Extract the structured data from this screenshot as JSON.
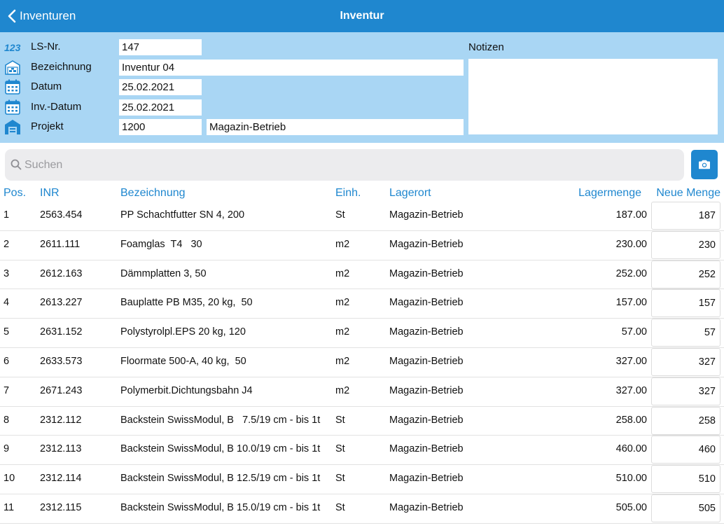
{
  "navbar": {
    "back_label": "Inventuren",
    "title": "Inventur",
    "bg_color": "#1f87cf"
  },
  "form": {
    "bg_color": "#a9d6f4",
    "ls_nr": {
      "label": "LS-Nr.",
      "value": "147",
      "icon": "numbers-123-icon"
    },
    "bezeichnung": {
      "label": "Bezeichnung",
      "value": "Inventur 04",
      "icon": "warehouse-icon"
    },
    "datum": {
      "label": "Datum",
      "value": "25.02.2021",
      "icon": "calendar-icon"
    },
    "inv_datum": {
      "label": "Inv.-Datum",
      "value": "25.02.2021",
      "icon": "calendar-icon"
    },
    "projekt": {
      "label": "Projekt",
      "value": "1200",
      "name": "Magazin-Betrieb",
      "icon": "building-icon"
    },
    "notizen": {
      "label": "Notizen",
      "value": ""
    }
  },
  "search": {
    "placeholder": "Suchen",
    "value": "",
    "camera_icon": "camera-icon"
  },
  "table": {
    "headers": {
      "pos": "Pos.",
      "inr": "INR",
      "bezeichnung": "Bezeichnung",
      "einh": "Einh.",
      "lagerort": "Lagerort",
      "lagermenge": "Lagermenge",
      "neue_menge": "Neue Menge"
    },
    "rows": [
      {
        "pos": "1",
        "inr": "2563.454",
        "bezeichnung": "PP Schachtfutter SN 4, 200",
        "einh": "St",
        "lagerort": "Magazin-Betrieb",
        "lagermenge": "187.00",
        "neue_menge": "187"
      },
      {
        "pos": "2",
        "inr": "2611.111",
        "bezeichnung": "Foamglas  T4   30",
        "einh": "m2",
        "lagerort": "Magazin-Betrieb",
        "lagermenge": "230.00",
        "neue_menge": "230"
      },
      {
        "pos": "3",
        "inr": "2612.163",
        "bezeichnung": "Dämmplatten 3, 50",
        "einh": "m2",
        "lagerort": "Magazin-Betrieb",
        "lagermenge": "252.00",
        "neue_menge": "252"
      },
      {
        "pos": "4",
        "inr": "2613.227",
        "bezeichnung": "Bauplatte PB M35, 20 kg,  50",
        "einh": "m2",
        "lagerort": "Magazin-Betrieb",
        "lagermenge": "157.00",
        "neue_menge": "157"
      },
      {
        "pos": "5",
        "inr": "2631.152",
        "bezeichnung": "Polystyrolpl.EPS 20 kg, 120",
        "einh": "m2",
        "lagerort": "Magazin-Betrieb",
        "lagermenge": "57.00",
        "neue_menge": "57"
      },
      {
        "pos": "6",
        "inr": "2633.573",
        "bezeichnung": "Floormate 500-A, 40 kg,  50",
        "einh": "m2",
        "lagerort": "Magazin-Betrieb",
        "lagermenge": "327.00",
        "neue_menge": "327"
      },
      {
        "pos": "7",
        "inr": "2671.243",
        "bezeichnung": "Polymerbit.Dichtungsbahn J4",
        "einh": "m2",
        "lagerort": "Magazin-Betrieb",
        "lagermenge": "327.00",
        "neue_menge": "327"
      },
      {
        "pos": "8",
        "inr": "2312.112",
        "bezeichnung": "Backstein SwissModul, B   7.5/19 cm - bis 1t",
        "einh": "St",
        "lagerort": "Magazin-Betrieb",
        "lagermenge": "258.00",
        "neue_menge": "258"
      },
      {
        "pos": "9",
        "inr": "2312.113",
        "bezeichnung": "Backstein SwissModul, B 10.0/19 cm - bis 1t",
        "einh": "St",
        "lagerort": "Magazin-Betrieb",
        "lagermenge": "460.00",
        "neue_menge": "460"
      },
      {
        "pos": "10",
        "inr": "2312.114",
        "bezeichnung": "Backstein SwissModul, B 12.5/19 cm - bis 1t",
        "einh": "St",
        "lagerort": "Magazin-Betrieb",
        "lagermenge": "510.00",
        "neue_menge": "510"
      },
      {
        "pos": "11",
        "inr": "2312.115",
        "bezeichnung": "Backstein SwissModul, B 15.0/19 cm - bis 1t",
        "einh": "St",
        "lagerort": "Magazin-Betrieb",
        "lagermenge": "505.00",
        "neue_menge": "505"
      }
    ]
  }
}
